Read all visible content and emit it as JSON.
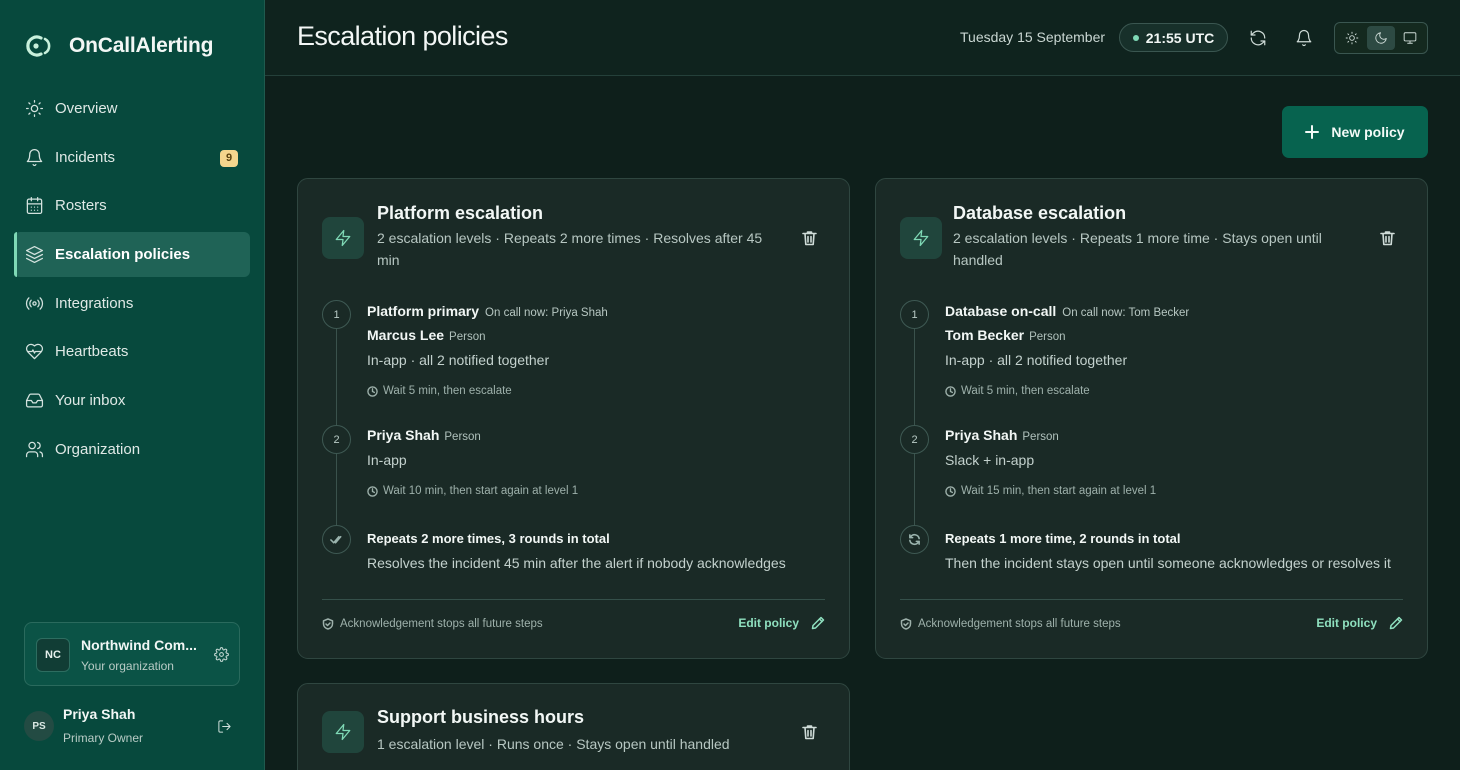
{
  "app": {
    "name": "OnCallAlerting"
  },
  "sidebar": {
    "items": [
      {
        "label": "Overview",
        "icon": "sun-icon"
      },
      {
        "label": "Incidents",
        "icon": "bell-icon",
        "badge": "9"
      },
      {
        "label": "Rosters",
        "icon": "calendar-icon"
      },
      {
        "label": "Escalation policies",
        "icon": "layers-icon",
        "active": true
      },
      {
        "label": "Integrations",
        "icon": "broadcast-icon"
      },
      {
        "label": "Heartbeats",
        "icon": "heart-pulse-icon"
      },
      {
        "label": "Your inbox",
        "icon": "inbox-icon"
      },
      {
        "label": "Organization",
        "icon": "users-icon"
      }
    ],
    "org": {
      "initials": "NC",
      "name": "Northwind Com...",
      "subtitle": "Your organization"
    },
    "user": {
      "initials": "PS",
      "name": "Priya Shah",
      "role": "Primary Owner"
    }
  },
  "header": {
    "title": "Escalation policies",
    "date": "Tuesday 15 September",
    "time": "21:55 UTC"
  },
  "actions": {
    "new_policy": "New policy"
  },
  "policies": [
    {
      "title": "Platform escalation",
      "summary": "2 escalation levels · Repeats 2 more times · Resolves after 45 min",
      "levels": [
        {
          "number": "1",
          "name": "Platform primary",
          "on_call": "On call now: Priya Shah",
          "person": "Marcus Lee",
          "person_tag": "Person",
          "channel": "In-app · all 2 notified together",
          "wait": "Wait 5 min, then escalate"
        },
        {
          "number": "2",
          "person": "Priya Shah",
          "person_tag": "Person",
          "channel": "In-app",
          "wait": "Wait 10 min, then start again at level 1"
        }
      ],
      "repeat_title": "Repeats 2 more times, 3 rounds in total",
      "repeat_desc": "Resolves the incident 45 min after the alert if nobody acknowledges",
      "ack_note": "Acknowledgement stops all future steps",
      "edit_label": "Edit policy"
    },
    {
      "title": "Database escalation",
      "summary": "2 escalation levels · Repeats 1 more time · Stays open until handled",
      "levels": [
        {
          "number": "1",
          "name": "Database on-call",
          "on_call": "On call now: Tom Becker",
          "person": "Tom Becker",
          "person_tag": "Person",
          "channel": "In-app · all 2 notified together",
          "wait": "Wait 5 min, then escalate"
        },
        {
          "number": "2",
          "person": "Priya Shah",
          "person_tag": "Person",
          "channel": "Slack + in-app",
          "wait": "Wait 15 min, then start again at level 1"
        }
      ],
      "repeat_title": "Repeats 1 more time, 2 rounds in total",
      "repeat_desc": "Then the incident stays open until someone acknowledges or resolves it",
      "ack_note": "Acknowledgement stops all future steps",
      "edit_label": "Edit policy"
    },
    {
      "title": "Support business hours",
      "summary": "1 escalation level · Runs once · Stays open until handled"
    }
  ],
  "colors": {
    "accent": "#7fd9b6",
    "sidebar_bg": "#07493d",
    "card_bg": "#1a2a26",
    "badge": "#f4d58d"
  }
}
